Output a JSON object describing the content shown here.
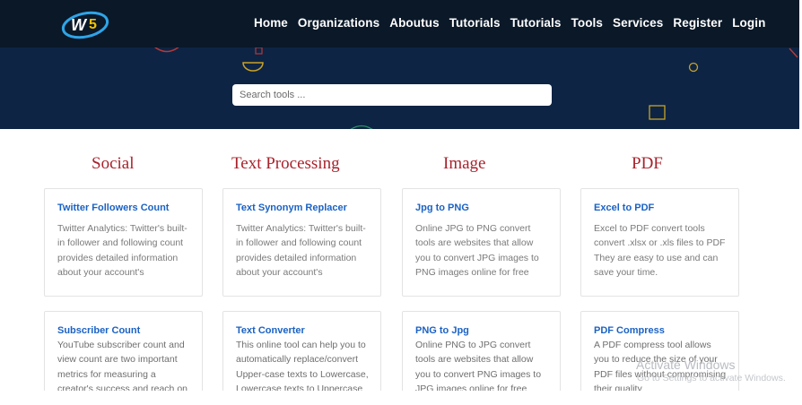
{
  "nav": {
    "items": [
      "Home",
      "Organizations",
      "Aboutus",
      "Tutorials",
      "Tutorials",
      "Tools",
      "Services",
      "Register",
      "Login"
    ]
  },
  "search": {
    "placeholder": "Search tools ..."
  },
  "categories": [
    "Social",
    "Text Processing",
    "Image",
    "PDF"
  ],
  "cards": {
    "row1": [
      {
        "title": "Twitter Followers Count",
        "desc": "Twitter Analytics: Twitter's built-in follower and following count provides detailed information about your account's"
      },
      {
        "title": "Text Synonym Replacer",
        "desc": "Twitter Analytics: Twitter's built-in follower and following count provides detailed information about your account's"
      },
      {
        "title": "Jpg to PNG",
        "desc": "Online JPG to PNG convert tools are websites that allow you to convert JPG images to PNG images online for free"
      },
      {
        "title": "Excel to PDF",
        "desc": "Excel to PDF convert tools convert .xlsx or .xls files to PDF They are easy to use and can save your time."
      }
    ],
    "row2": [
      {
        "title": "Subscriber Count",
        "desc": "YouTube subscriber count and view count are two important metrics for measuring a creator's success and reach on the"
      },
      {
        "title": "Text Converter",
        "desc": "This online tool can help you to automatically replace/convert Upper-case texts to Lowercase, Lowercase texts to Uppercase"
      },
      {
        "title": "PNG to Jpg",
        "desc": "Online PNG to JPG convert tools are websites that allow you to convert PNG images to JPG images online for free"
      },
      {
        "title": "PDF Compress",
        "desc": "A PDF compress tool allows you to reduce the size of your PDF files without compromising their quality"
      }
    ]
  },
  "watermark": {
    "line1": "Activate Windows",
    "line2": "Go to Settings to activate Windows."
  },
  "colors": {
    "navbar": "#0a1828",
    "hero": "#0d2444",
    "category": "#a8222c",
    "link": "#1b62c4",
    "decoration": "#c9a227"
  }
}
